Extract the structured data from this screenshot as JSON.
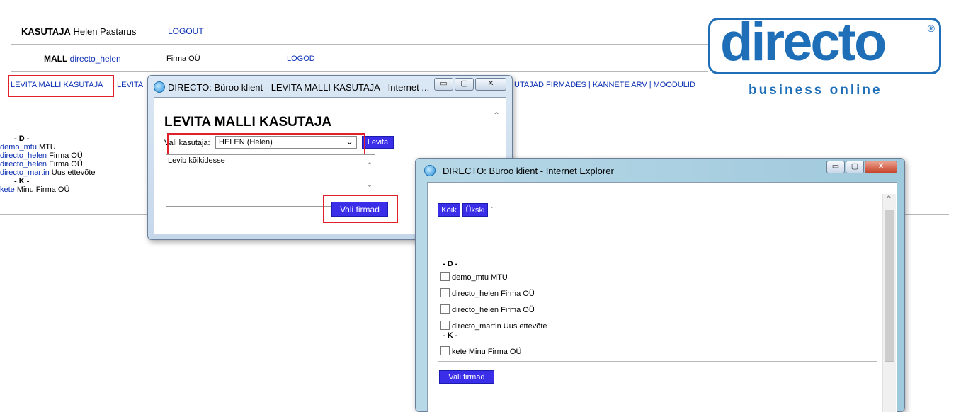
{
  "header": {
    "kasutaja_label": "KASUTAJA",
    "kasutaja_name": "Helen Pastarus",
    "logout": "LOGOUT",
    "mall_label": "MALL",
    "mall_value": "directo_helen",
    "firma": "Firma OÜ",
    "logod": "LOGOD"
  },
  "nav": {
    "item1": "LEVITA MALLI KASUTAJA",
    "item2": "LEVITA",
    "item_rest": "UTAJAD FIRMADES | KANNETE ARV | MOODULID"
  },
  "logo": {
    "text": "directo",
    "reg": "®",
    "sub": "business online"
  },
  "left_list": {
    "groups": [
      {
        "head": "- D -",
        "items": [
          {
            "code": "demo_mtu",
            "name": "MTU"
          },
          {
            "code": "directo_helen",
            "name": "Firma OÜ"
          },
          {
            "code": "directo_helen",
            "name": "Firma OÜ"
          },
          {
            "code": "directo_martin",
            "name": "Uus ettevõte"
          }
        ]
      },
      {
        "head": "- K -",
        "items": [
          {
            "code": "kete",
            "name": "Minu Firma OÜ"
          }
        ]
      }
    ]
  },
  "popup1": {
    "title": "DIRECTO: Büroo klient - LEVITA MALLI KASUTAJA - Internet ...",
    "heading": "LEVITA MALLI KASUTAJA",
    "select_label": "Vali kasutaja:",
    "select_value": "HELEN (Helen)",
    "levita_btn": "Levita",
    "textarea_value": "Levib kõikidesse",
    "vali_btn": "Vali firmad",
    "ctrl_min": "▭",
    "ctrl_max": "▢",
    "ctrl_close": "✕"
  },
  "popup2": {
    "title": "DIRECTO: Büroo klient - Internet Explorer",
    "koik_btn": "Kõik",
    "ukski_btn": "Ükski",
    "dot": "·",
    "groups": [
      {
        "head": "- D -",
        "items": [
          "demo_mtu MTU",
          "directo_helen Firma OÜ",
          "directo_helen Firma OÜ",
          "directo_martin Uus ettevõte"
        ]
      },
      {
        "head": "- K -",
        "items": [
          "kete Minu Firma OÜ"
        ]
      }
    ],
    "vali_btn": "Vali firmad",
    "ctrl_min": "▭",
    "ctrl_max": "▢",
    "ctrl_close": "X"
  },
  "colors": {
    "link": "#0b2fb3",
    "accent_button": "#3a2ee8",
    "highlight": "#e0202a",
    "logo": "#1e6fb8"
  }
}
